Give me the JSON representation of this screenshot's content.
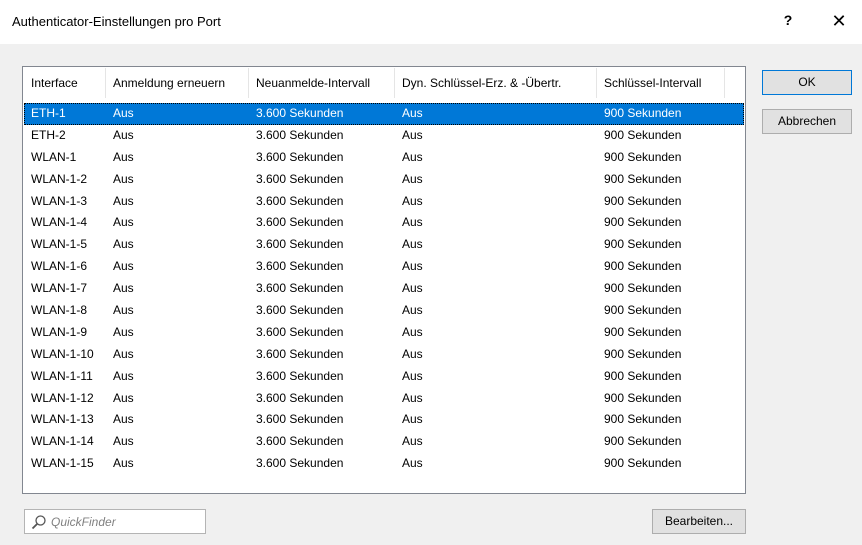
{
  "window": {
    "title": "Authenticator-Einstellungen pro Port",
    "help": "?",
    "close": "✕"
  },
  "buttons": {
    "ok": "OK",
    "cancel": "Abbrechen",
    "edit": "Bearbeiten..."
  },
  "quickfinder": {
    "placeholder": "QuickFinder"
  },
  "table": {
    "columns": [
      "Interface",
      "Anmeldung erneuern",
      "Neuanmelde-Intervall",
      "Dyn. Schlüssel-Erz. & -Übertr.",
      "Schlüssel-Intervall"
    ],
    "rows": [
      [
        "ETH-1",
        "Aus",
        "3.600 Sekunden",
        "Aus",
        "900 Sekunden"
      ],
      [
        "ETH-2",
        "Aus",
        "3.600 Sekunden",
        "Aus",
        "900 Sekunden"
      ],
      [
        "WLAN-1",
        "Aus",
        "3.600 Sekunden",
        "Aus",
        "900 Sekunden"
      ],
      [
        "WLAN-1-2",
        "Aus",
        "3.600 Sekunden",
        "Aus",
        "900 Sekunden"
      ],
      [
        "WLAN-1-3",
        "Aus",
        "3.600 Sekunden",
        "Aus",
        "900 Sekunden"
      ],
      [
        "WLAN-1-4",
        "Aus",
        "3.600 Sekunden",
        "Aus",
        "900 Sekunden"
      ],
      [
        "WLAN-1-5",
        "Aus",
        "3.600 Sekunden",
        "Aus",
        "900 Sekunden"
      ],
      [
        "WLAN-1-6",
        "Aus",
        "3.600 Sekunden",
        "Aus",
        "900 Sekunden"
      ],
      [
        "WLAN-1-7",
        "Aus",
        "3.600 Sekunden",
        "Aus",
        "900 Sekunden"
      ],
      [
        "WLAN-1-8",
        "Aus",
        "3.600 Sekunden",
        "Aus",
        "900 Sekunden"
      ],
      [
        "WLAN-1-9",
        "Aus",
        "3.600 Sekunden",
        "Aus",
        "900 Sekunden"
      ],
      [
        "WLAN-1-10",
        "Aus",
        "3.600 Sekunden",
        "Aus",
        "900 Sekunden"
      ],
      [
        "WLAN-1-11",
        "Aus",
        "3.600 Sekunden",
        "Aus",
        "900 Sekunden"
      ],
      [
        "WLAN-1-12",
        "Aus",
        "3.600 Sekunden",
        "Aus",
        "900 Sekunden"
      ],
      [
        "WLAN-1-13",
        "Aus",
        "3.600 Sekunden",
        "Aus",
        "900 Sekunden"
      ],
      [
        "WLAN-1-14",
        "Aus",
        "3.600 Sekunden",
        "Aus",
        "900 Sekunden"
      ],
      [
        "WLAN-1-15",
        "Aus",
        "3.600 Sekunden",
        "Aus",
        "900 Sekunden"
      ]
    ]
  }
}
